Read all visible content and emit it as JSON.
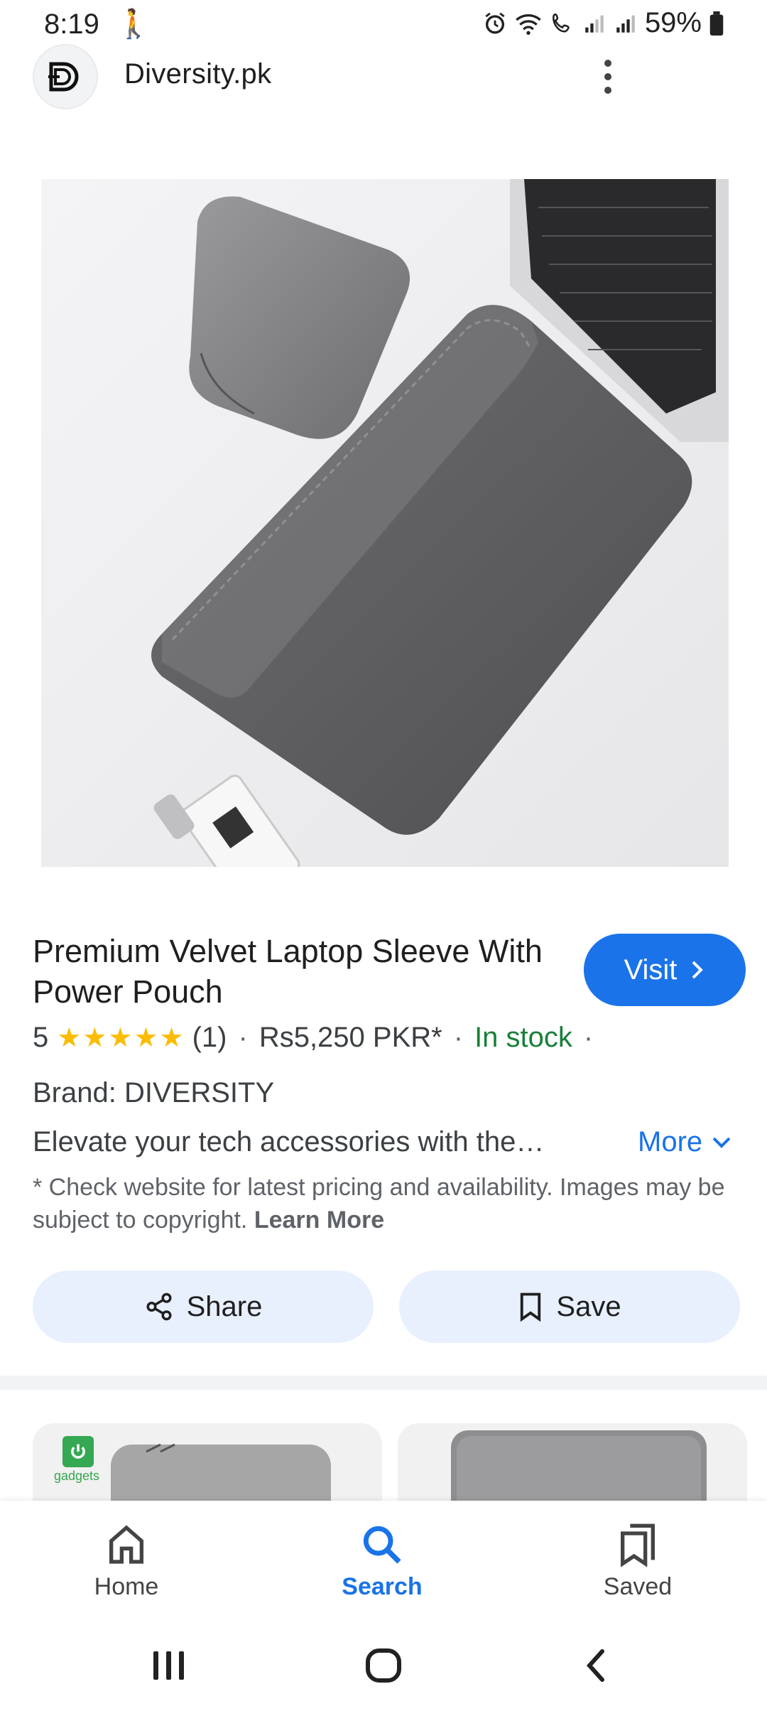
{
  "status_bar": {
    "time": "8:19",
    "battery": "59%"
  },
  "header": {
    "site_name": "Diversity.pk"
  },
  "product": {
    "title": "Premium Velvet Laptop Sleeve With Power Pouch",
    "visit_label": "Visit",
    "rating_value": "5",
    "stars": "★★★★★",
    "rating_count": "(1)",
    "price": "Rs5,250 PKR*",
    "availability": "In stock",
    "brand": "Brand: DIVERSITY",
    "description": "Elevate your tech accessories with the…",
    "more_label": "More",
    "disclaimer": "* Check website for latest pricing and availability. Images may be subject to copyright.",
    "learn_more": "Learn More"
  },
  "actions": {
    "share_label": "Share",
    "save_label": "Save"
  },
  "related": {
    "card1_logo_text": "gadgets"
  },
  "bottom_nav": {
    "home": "Home",
    "search": "Search",
    "saved": "Saved"
  },
  "colors": {
    "accent": "#1a73e8",
    "stock_green": "#188038",
    "star": "#fbbc04",
    "pill_bg": "#e8f0fe"
  }
}
